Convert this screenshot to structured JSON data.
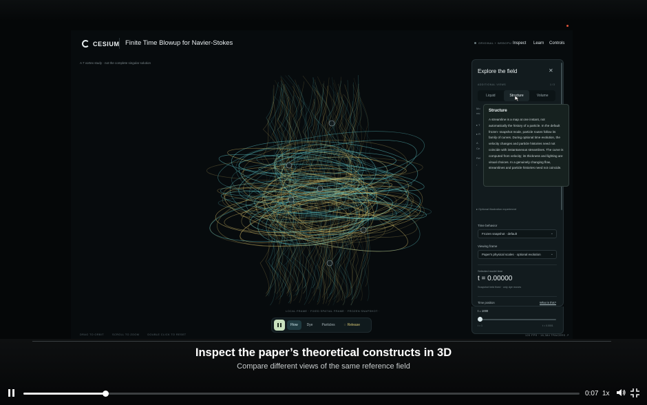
{
  "app": {
    "brand": "CESIUM",
    "title": "Finite Time Blowup for Navier-Stokes",
    "status_chip": "ORIGINAL + WEBGPU",
    "nav": [
      "Inspect",
      "Learn",
      "Controls"
    ],
    "subcaption": "A 7 vortex study · not the complete singular solution",
    "frame_label": "LOCAL FRAME · FIXED SPATIAL FRAME · FROZEN SNAPSHOT ·",
    "hints": [
      "DRAG TO ORBIT",
      "SCROLL TO ZOOM",
      "DOUBLE CLICK TO RESET"
    ],
    "stats": "120 FPS  ·  16,384 TRACERS  ↗"
  },
  "toolbar": {
    "items": [
      "Flow",
      "Dye",
      "Particles"
    ],
    "active": "Flow",
    "release_label": "Release"
  },
  "panel": {
    "title": "Explore the field",
    "close": "✕",
    "subheader": "ADDITIONAL VIEWS",
    "subheader_right": "1 / 3",
    "tabs": [
      "Liquid",
      "Structure",
      "Volume"
    ],
    "active_tab": "Structure",
    "ghost_lines": [
      "Mo",
      "rec",
      "▸ T",
      "▸ R",
      "A",
      "Ce",
      "Rel",
      "‹",
      "",
      "▸ Optional illustration experiment"
    ],
    "time_behavior_label": "Time behavior",
    "time_behavior_value": "Frozen snapshot · default",
    "viewing_frame_label": "Viewing frame",
    "viewing_frame_value": "Paper's physical scales · optional evolution",
    "selected_time_label": "Selected model time",
    "selected_time_value": "t = 0.00000",
    "selected_time_note": "Snapshot held fixed · only dye moves",
    "time_position_label": "Time position",
    "what_is_this": "What is this?",
    "slider_value": "t = 1000",
    "slider_min": "t = 1",
    "slider_max": "t = 0.0001",
    "slider_fraction": 0.0
  },
  "tooltip": {
    "title": "Structure",
    "body": "A streamline is a map at one instant, not automatically the history of a particle. In the default frozen- snapshot mode, particle routes follow its family of curves. During optional time evolution, the velocity changes and particle histories need not coincide with instantaneous streamlines. The curve is computed from velocity; its thickness and lighting are visual choices. In a genuinely changing flow, streamlines and particle histories need not coincide."
  },
  "caption": {
    "title": "Inspect the paper’s theoretical constructs in 3D",
    "subtitle": "Compare different views of the same reference field"
  },
  "player": {
    "current_time": "0:07",
    "speed": "1x",
    "progress": 0.147,
    "colors": {
      "teal": "#5fc7c9",
      "gold": "#d9c26c",
      "accent_green": "#c9e2bf"
    }
  }
}
